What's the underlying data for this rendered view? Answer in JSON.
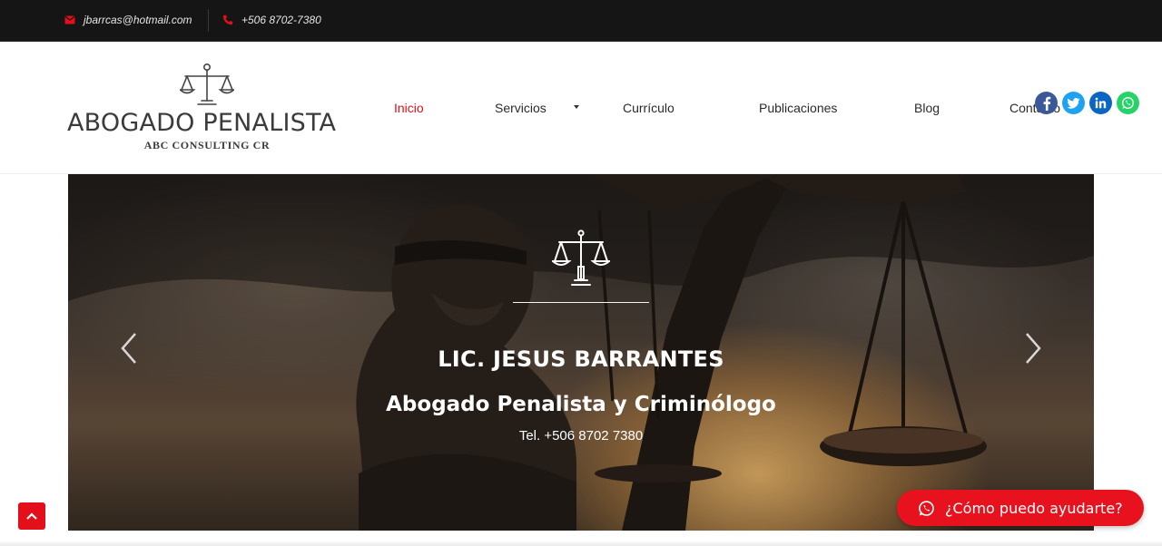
{
  "topbar": {
    "email": "jbarrcas@hotmail.com",
    "phone": "+506 8702-7380"
  },
  "logo": {
    "title": "ABOGADO PENALISTA",
    "subtitle": "ABC CONSULTING CR"
  },
  "nav": {
    "items": [
      {
        "label": "Inicio",
        "active": true
      },
      {
        "label": "Servicios",
        "has_dropdown": true
      },
      {
        "label": "Currículo"
      },
      {
        "label": "Publicaciones"
      },
      {
        "label": "Blog"
      },
      {
        "label": "Contacto"
      }
    ]
  },
  "social": [
    "facebook-icon",
    "twitter-icon",
    "linkedin-icon",
    "whatsapp-icon"
  ],
  "hero": {
    "name": "LIC. JESUS BARRANTES",
    "role": "Abogado Penalista y Criminólogo",
    "tel": "Tel. +506 8702 7380"
  },
  "help": {
    "label": "¿Cómo puedo ayudarte?"
  },
  "colors": {
    "accent": "#e3101b",
    "topbar": "#151515",
    "facebook": "#3b5998",
    "twitter": "#1da1f2",
    "linkedin": "#0a66c2",
    "whatsapp": "#25d366"
  }
}
